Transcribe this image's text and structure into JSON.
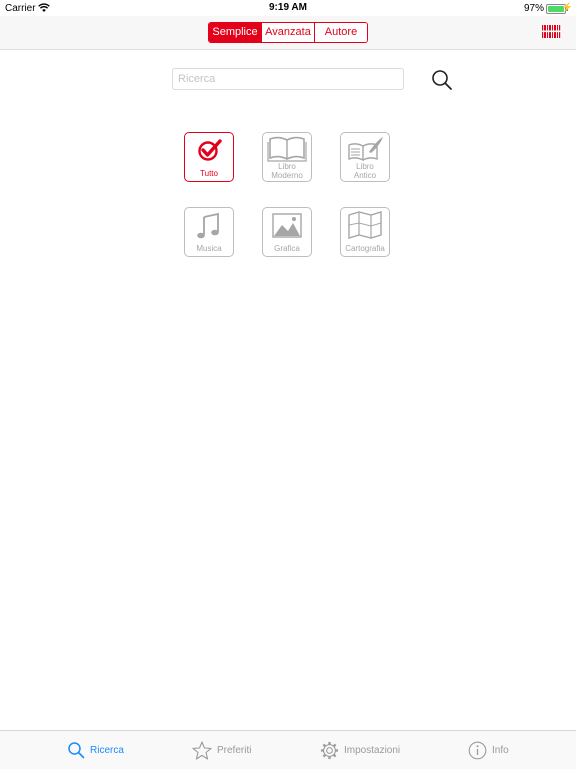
{
  "status_bar": {
    "carrier": "Carrier",
    "time": "9:19 AM",
    "battery": "97%",
    "battery_level": 0.97
  },
  "nav": {
    "segments": [
      {
        "label": "Semplice",
        "active": true
      },
      {
        "label": "Avanzata",
        "active": false
      },
      {
        "label": "Autore",
        "active": false
      }
    ],
    "barcode_icon": "barcode-icon",
    "accent_color": "#e3001b"
  },
  "search": {
    "placeholder": "Ricerca",
    "value": "",
    "icon": "magnifier-icon"
  },
  "categories": [
    {
      "label": "Tutto",
      "icon": "checkmark-icon",
      "active": true
    },
    {
      "label_line1": "Libro",
      "label_line2": "Moderno",
      "icon": "open-book-icon",
      "active": false
    },
    {
      "label_line1": "Libro",
      "label_line2": "Antico",
      "icon": "quill-book-icon",
      "active": false
    },
    {
      "label": "Musica",
      "icon": "music-note-icon",
      "active": false
    },
    {
      "label": "Grafica",
      "icon": "picture-icon",
      "active": false
    },
    {
      "label": "Cartografia",
      "icon": "map-icon",
      "active": false
    }
  ],
  "tabs": [
    {
      "label": "Ricerca",
      "icon": "search-icon",
      "active": true
    },
    {
      "label": "Preferiti",
      "icon": "star-icon",
      "active": false
    },
    {
      "label": "Impostazioni",
      "icon": "gear-icon",
      "active": false
    },
    {
      "label": "Info",
      "icon": "info-icon",
      "active": false
    }
  ],
  "colors": {
    "tab_active": "#1a8cff",
    "tab_inactive": "#9a9a9a",
    "tile_inactive": "#a6a6a6"
  }
}
